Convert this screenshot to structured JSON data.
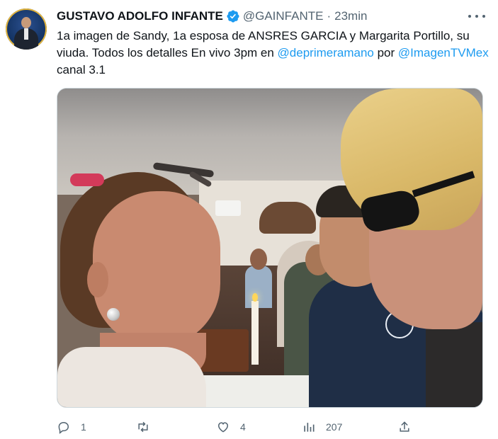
{
  "author": {
    "name": "GUSTAVO ADOLFO INFANTE",
    "handle": "@GAINFANTE",
    "separator": "·",
    "time": "23min",
    "verified": true
  },
  "tweet": {
    "text_part1": "1a imagen de Sandy, 1a esposa de ANSRES GARCIA y Margarita Portillo, su viuda. Todos los detalles En vivo 3pm en ",
    "mention1": "@deprimeramano",
    "text_part2": " por ",
    "mention2": "@ImagenTVMex",
    "text_part3": " canal 3.1"
  },
  "media": {
    "icon": "photo"
  },
  "actions": {
    "reply_count": "1",
    "retweet_count": "",
    "like_count": "4",
    "views_count": "207"
  },
  "colors": {
    "link": "#1d9bf0",
    "muted": "#536471",
    "verified": "#1d9bf0"
  }
}
